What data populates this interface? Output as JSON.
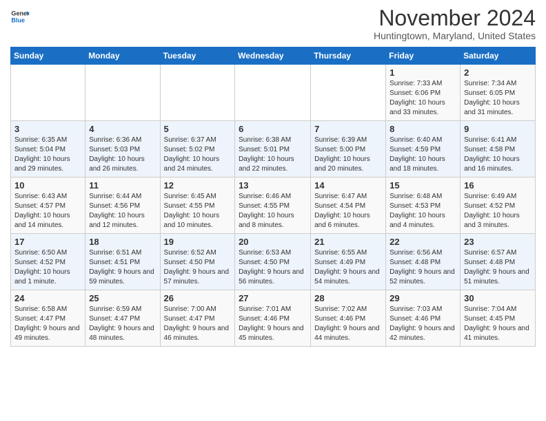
{
  "header": {
    "logo_line1": "General",
    "logo_line2": "Blue",
    "month": "November 2024",
    "location": "Huntingtown, Maryland, United States"
  },
  "days_of_week": [
    "Sunday",
    "Monday",
    "Tuesday",
    "Wednesday",
    "Thursday",
    "Friday",
    "Saturday"
  ],
  "weeks": [
    [
      {
        "day": "",
        "info": ""
      },
      {
        "day": "",
        "info": ""
      },
      {
        "day": "",
        "info": ""
      },
      {
        "day": "",
        "info": ""
      },
      {
        "day": "",
        "info": ""
      },
      {
        "day": "1",
        "info": "Sunrise: 7:33 AM\nSunset: 6:06 PM\nDaylight: 10 hours and 33 minutes."
      },
      {
        "day": "2",
        "info": "Sunrise: 7:34 AM\nSunset: 6:05 PM\nDaylight: 10 hours and 31 minutes."
      }
    ],
    [
      {
        "day": "3",
        "info": "Sunrise: 6:35 AM\nSunset: 5:04 PM\nDaylight: 10 hours and 29 minutes."
      },
      {
        "day": "4",
        "info": "Sunrise: 6:36 AM\nSunset: 5:03 PM\nDaylight: 10 hours and 26 minutes."
      },
      {
        "day": "5",
        "info": "Sunrise: 6:37 AM\nSunset: 5:02 PM\nDaylight: 10 hours and 24 minutes."
      },
      {
        "day": "6",
        "info": "Sunrise: 6:38 AM\nSunset: 5:01 PM\nDaylight: 10 hours and 22 minutes."
      },
      {
        "day": "7",
        "info": "Sunrise: 6:39 AM\nSunset: 5:00 PM\nDaylight: 10 hours and 20 minutes."
      },
      {
        "day": "8",
        "info": "Sunrise: 6:40 AM\nSunset: 4:59 PM\nDaylight: 10 hours and 18 minutes."
      },
      {
        "day": "9",
        "info": "Sunrise: 6:41 AM\nSunset: 4:58 PM\nDaylight: 10 hours and 16 minutes."
      }
    ],
    [
      {
        "day": "10",
        "info": "Sunrise: 6:43 AM\nSunset: 4:57 PM\nDaylight: 10 hours and 14 minutes."
      },
      {
        "day": "11",
        "info": "Sunrise: 6:44 AM\nSunset: 4:56 PM\nDaylight: 10 hours and 12 minutes."
      },
      {
        "day": "12",
        "info": "Sunrise: 6:45 AM\nSunset: 4:55 PM\nDaylight: 10 hours and 10 minutes."
      },
      {
        "day": "13",
        "info": "Sunrise: 6:46 AM\nSunset: 4:55 PM\nDaylight: 10 hours and 8 minutes."
      },
      {
        "day": "14",
        "info": "Sunrise: 6:47 AM\nSunset: 4:54 PM\nDaylight: 10 hours and 6 minutes."
      },
      {
        "day": "15",
        "info": "Sunrise: 6:48 AM\nSunset: 4:53 PM\nDaylight: 10 hours and 4 minutes."
      },
      {
        "day": "16",
        "info": "Sunrise: 6:49 AM\nSunset: 4:52 PM\nDaylight: 10 hours and 3 minutes."
      }
    ],
    [
      {
        "day": "17",
        "info": "Sunrise: 6:50 AM\nSunset: 4:52 PM\nDaylight: 10 hours and 1 minute."
      },
      {
        "day": "18",
        "info": "Sunrise: 6:51 AM\nSunset: 4:51 PM\nDaylight: 9 hours and 59 minutes."
      },
      {
        "day": "19",
        "info": "Sunrise: 6:52 AM\nSunset: 4:50 PM\nDaylight: 9 hours and 57 minutes."
      },
      {
        "day": "20",
        "info": "Sunrise: 6:53 AM\nSunset: 4:50 PM\nDaylight: 9 hours and 56 minutes."
      },
      {
        "day": "21",
        "info": "Sunrise: 6:55 AM\nSunset: 4:49 PM\nDaylight: 9 hours and 54 minutes."
      },
      {
        "day": "22",
        "info": "Sunrise: 6:56 AM\nSunset: 4:48 PM\nDaylight: 9 hours and 52 minutes."
      },
      {
        "day": "23",
        "info": "Sunrise: 6:57 AM\nSunset: 4:48 PM\nDaylight: 9 hours and 51 minutes."
      }
    ],
    [
      {
        "day": "24",
        "info": "Sunrise: 6:58 AM\nSunset: 4:47 PM\nDaylight: 9 hours and 49 minutes."
      },
      {
        "day": "25",
        "info": "Sunrise: 6:59 AM\nSunset: 4:47 PM\nDaylight: 9 hours and 48 minutes."
      },
      {
        "day": "26",
        "info": "Sunrise: 7:00 AM\nSunset: 4:47 PM\nDaylight: 9 hours and 46 minutes."
      },
      {
        "day": "27",
        "info": "Sunrise: 7:01 AM\nSunset: 4:46 PM\nDaylight: 9 hours and 45 minutes."
      },
      {
        "day": "28",
        "info": "Sunrise: 7:02 AM\nSunset: 4:46 PM\nDaylight: 9 hours and 44 minutes."
      },
      {
        "day": "29",
        "info": "Sunrise: 7:03 AM\nSunset: 4:46 PM\nDaylight: 9 hours and 42 minutes."
      },
      {
        "day": "30",
        "info": "Sunrise: 7:04 AM\nSunset: 4:45 PM\nDaylight: 9 hours and 41 minutes."
      }
    ]
  ]
}
